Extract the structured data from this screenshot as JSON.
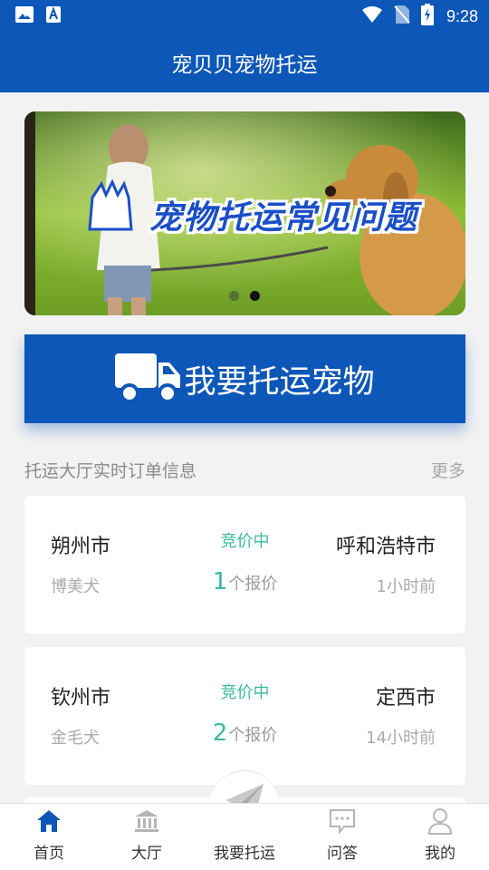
{
  "status_bar": {
    "time": "9:28",
    "icons": [
      "image-icon",
      "font-icon",
      "wifi-icon",
      "no-sim-icon",
      "battery-charging-icon"
    ]
  },
  "header": {
    "title": "宠贝贝宠物托运"
  },
  "banner": {
    "title": "宠物托运常见问题",
    "dots": 2,
    "active_dot": 1
  },
  "ship_button": {
    "label": "我要托运宠物",
    "icon": "truck-icon"
  },
  "orders_section": {
    "title": "托运大厅实时订单信息",
    "more": "更多"
  },
  "orders": [
    {
      "from": "朔州市",
      "to": "呼和浩特市",
      "status": "竞价中",
      "breed": "博美犬",
      "quote_count": "1",
      "quote_suffix": "个报价",
      "time": "1小时前"
    },
    {
      "from": "钦州市",
      "to": "定西市",
      "status": "竞价中",
      "breed": "金毛犬",
      "quote_count": "2",
      "quote_suffix": "个报价",
      "time": "14小时前"
    }
  ],
  "tabbar": {
    "items": [
      {
        "label": "首页",
        "icon": "home-icon",
        "active": true
      },
      {
        "label": "大厅",
        "icon": "bank-icon",
        "active": false
      },
      {
        "label": "我要托运",
        "icon": "paper-plane-icon",
        "active": false
      },
      {
        "label": "问答",
        "icon": "chat-icon",
        "active": false
      },
      {
        "label": "我的",
        "icon": "user-icon",
        "active": false
      }
    ]
  },
  "colors": {
    "primary": "#0d57b8",
    "accent_teal": "#3db8a0",
    "background": "#f2f2f2"
  }
}
